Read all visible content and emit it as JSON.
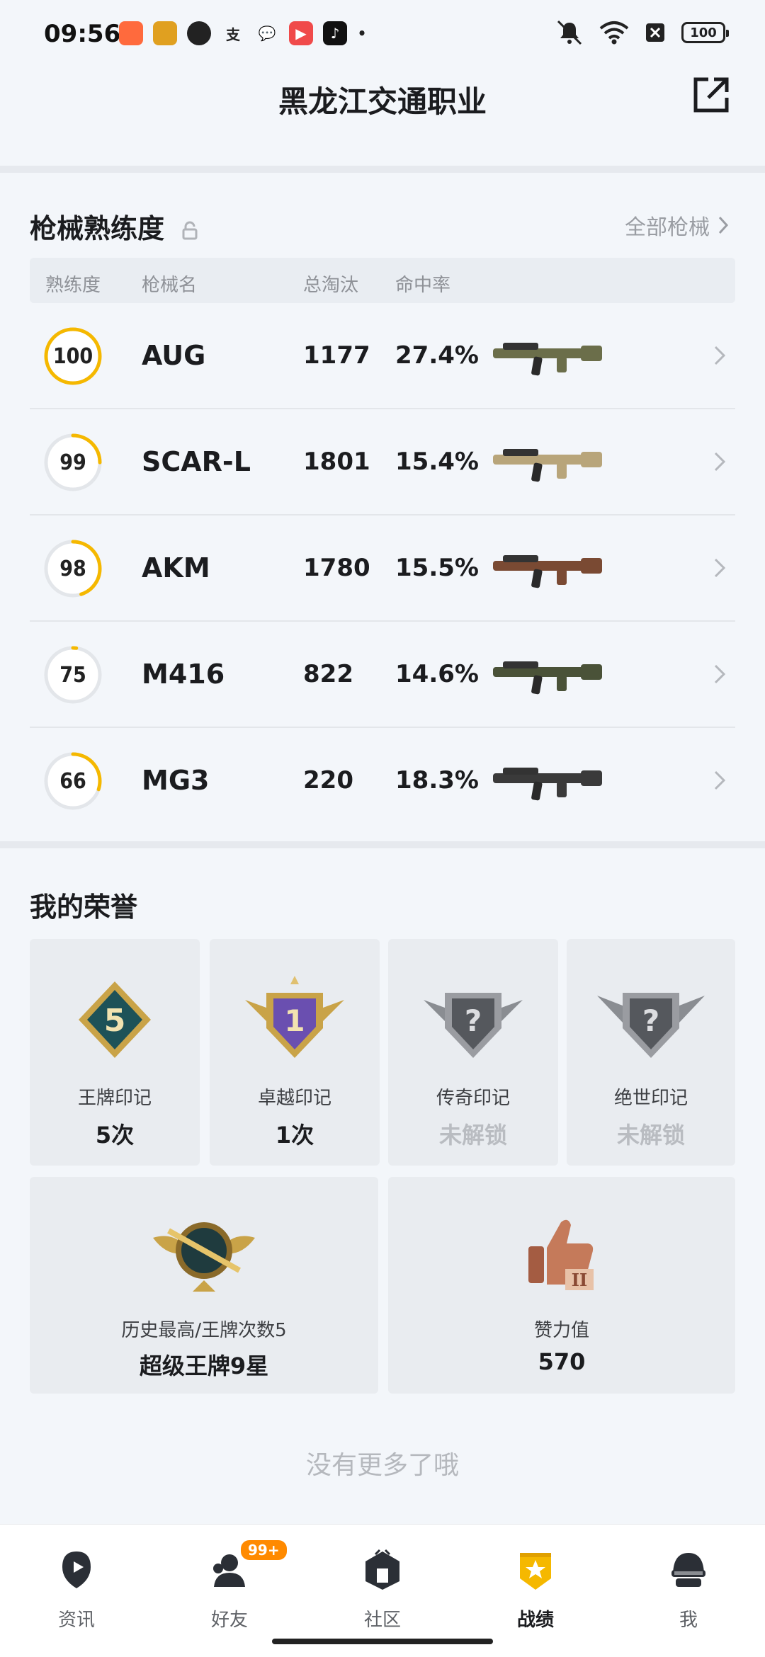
{
  "status_bar": {
    "time": "09:56",
    "battery": "100"
  },
  "header": {
    "title": "黑龙江交通职业"
  },
  "weapons": {
    "title": "枪械熟练度",
    "all_link": "全部枪械",
    "columns": {
      "proficiency": "熟练度",
      "name": "枪械名",
      "kills": "总淘汰",
      "accuracy": "命中率"
    },
    "rows": [
      {
        "proficiency": "100",
        "level": 1.0,
        "name": "AUG",
        "kills": "1177",
        "accuracy": "27.4%",
        "color": "#6b6e4a"
      },
      {
        "proficiency": "99",
        "level": 0.25,
        "name": "SCAR-L",
        "kills": "1801",
        "accuracy": "15.4%",
        "color": "#b8a57a"
      },
      {
        "proficiency": "98",
        "level": 0.45,
        "name": "AKM",
        "kills": "1780",
        "accuracy": "15.5%",
        "color": "#7a4a33"
      },
      {
        "proficiency": "75",
        "level": 0.02,
        "name": "M416",
        "kills": "822",
        "accuracy": "14.6%",
        "color": "#4a5238"
      },
      {
        "proficiency": "66",
        "level": 0.3,
        "name": "MG3",
        "kills": "220",
        "accuracy": "18.3%",
        "color": "#3a3a3a"
      }
    ]
  },
  "honors": {
    "title": "我的荣誉",
    "tiles": [
      {
        "label": "王牌印记",
        "value": "5次",
        "locked": false
      },
      {
        "label": "卓越印记",
        "value": "1次",
        "locked": false
      },
      {
        "label": "传奇印记",
        "value": "未解锁",
        "locked": true
      },
      {
        "label": "绝世印记",
        "value": "未解锁",
        "locked": true
      }
    ],
    "badge_numbers": {
      "ace": "5",
      "excellence": "1"
    },
    "history": {
      "label": "历史最高/王牌次数5",
      "value": "超级王牌9星"
    },
    "likes": {
      "label": "赞力值",
      "value": "570"
    }
  },
  "footer": {
    "no_more": "没有更多了哦"
  },
  "nav": {
    "items": [
      {
        "label": "资讯",
        "active": false
      },
      {
        "label": "好友",
        "active": false,
        "badge": "99+"
      },
      {
        "label": "社区",
        "active": false
      },
      {
        "label": "战绩",
        "active": true
      },
      {
        "label": "我",
        "active": false
      }
    ]
  },
  "colors": {
    "accent": "#f5b800",
    "ring_track": "#e3e6ea"
  }
}
